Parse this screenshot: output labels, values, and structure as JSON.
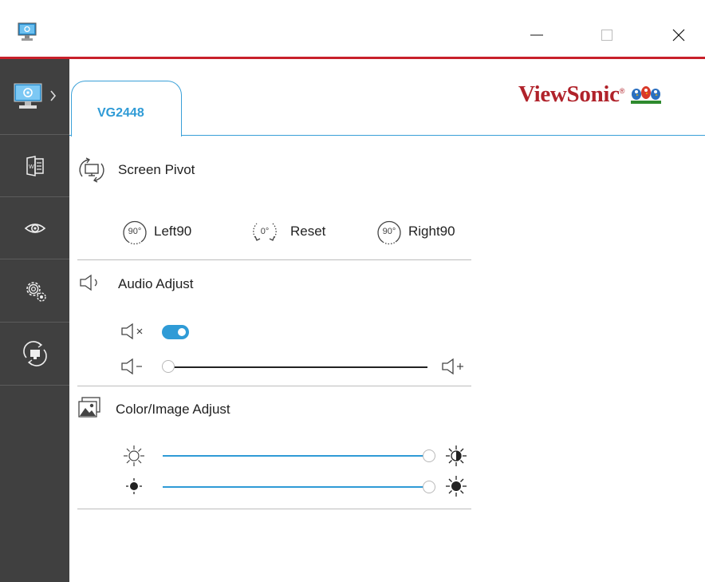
{
  "window": {
    "minimize_icon": "minimize-icon",
    "maximize_icon": "maximize-icon",
    "close_icon": "close-icon"
  },
  "sidebar": {
    "items": [
      {
        "name": "monitor-settings",
        "icon": "monitor-gear-icon"
      },
      {
        "name": "document",
        "icon": "document-icon"
      },
      {
        "name": "eye",
        "icon": "eye-icon"
      },
      {
        "name": "settings",
        "icon": "gears-icon"
      },
      {
        "name": "rotate",
        "icon": "rotate-icon"
      }
    ]
  },
  "tab": {
    "label": "VG2448"
  },
  "brand": {
    "name": "ViewSonic",
    "color": "#b0222a"
  },
  "screen_pivot": {
    "title": "Screen Pivot",
    "buttons": [
      {
        "label": "Left90",
        "icon_text": "90°"
      },
      {
        "label": "Reset",
        "icon_text": "0°"
      },
      {
        "label": "Right90",
        "icon_text": "90°"
      }
    ]
  },
  "audio": {
    "title": "Audio Adjust",
    "mute_toggle": true,
    "volume": 0
  },
  "color_image": {
    "title": "Color/Image Adjust",
    "contrast": 1.0,
    "brightness": 1.0
  },
  "colors": {
    "accent": "#2f9bd6",
    "sidebar": "#404040",
    "titlebar_line": "#c8202a"
  }
}
